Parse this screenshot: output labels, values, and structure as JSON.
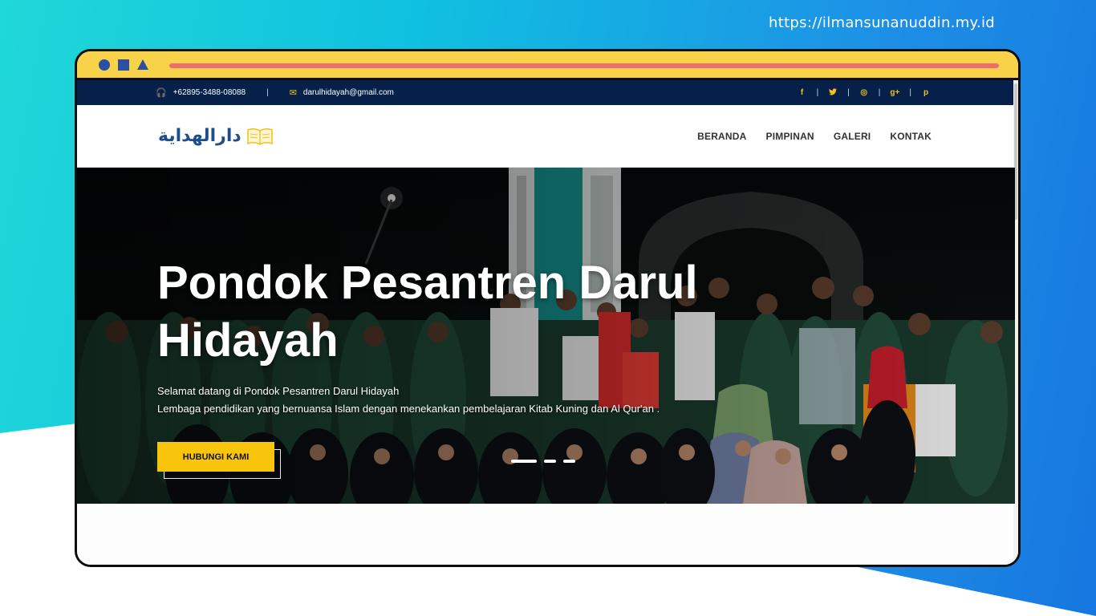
{
  "site_url": "https://ilmansunanuddin.my.id",
  "colors": {
    "topbar_bg": "#06204a",
    "accent_yellow": "#f8c40c",
    "logo_blue": "#1f4d8c",
    "browser_bar": "#f8d349",
    "browser_bar_line": "#ef6f6f"
  },
  "topbar": {
    "phone_icon": "headphones-icon",
    "phone": "+62895-3488-08088",
    "separator": "|",
    "email_icon": "envelope-icon",
    "email": "darulhidayah@gmail.com",
    "social": [
      {
        "name": "facebook-icon",
        "glyph": "f"
      },
      {
        "name": "twitter-icon",
        "glyph": "🐦"
      },
      {
        "name": "dribbble-icon",
        "glyph": "◎"
      },
      {
        "name": "google-plus-icon",
        "glyph": "g+"
      },
      {
        "name": "pinterest-icon",
        "glyph": "p"
      }
    ]
  },
  "logo": {
    "text": "دارالهداية",
    "icon": "open-book-icon"
  },
  "menu": [
    "BERANDA",
    "PIMPINAN",
    "GALERI",
    "KONTAK"
  ],
  "hero": {
    "title": "Pondok Pesantren Darul Hidayah",
    "subtitle_line1": "Selamat datang di Pondok Pesantren Darul Hidayah",
    "subtitle_line2": "Lembaga pendidikan yang bernuansa Islam dengan menekankan pembelajaran Kitab Kuning dan Al Qur'an .",
    "cta": "HUBUNGI KAMI",
    "slides": 3,
    "active_slide": 1
  }
}
